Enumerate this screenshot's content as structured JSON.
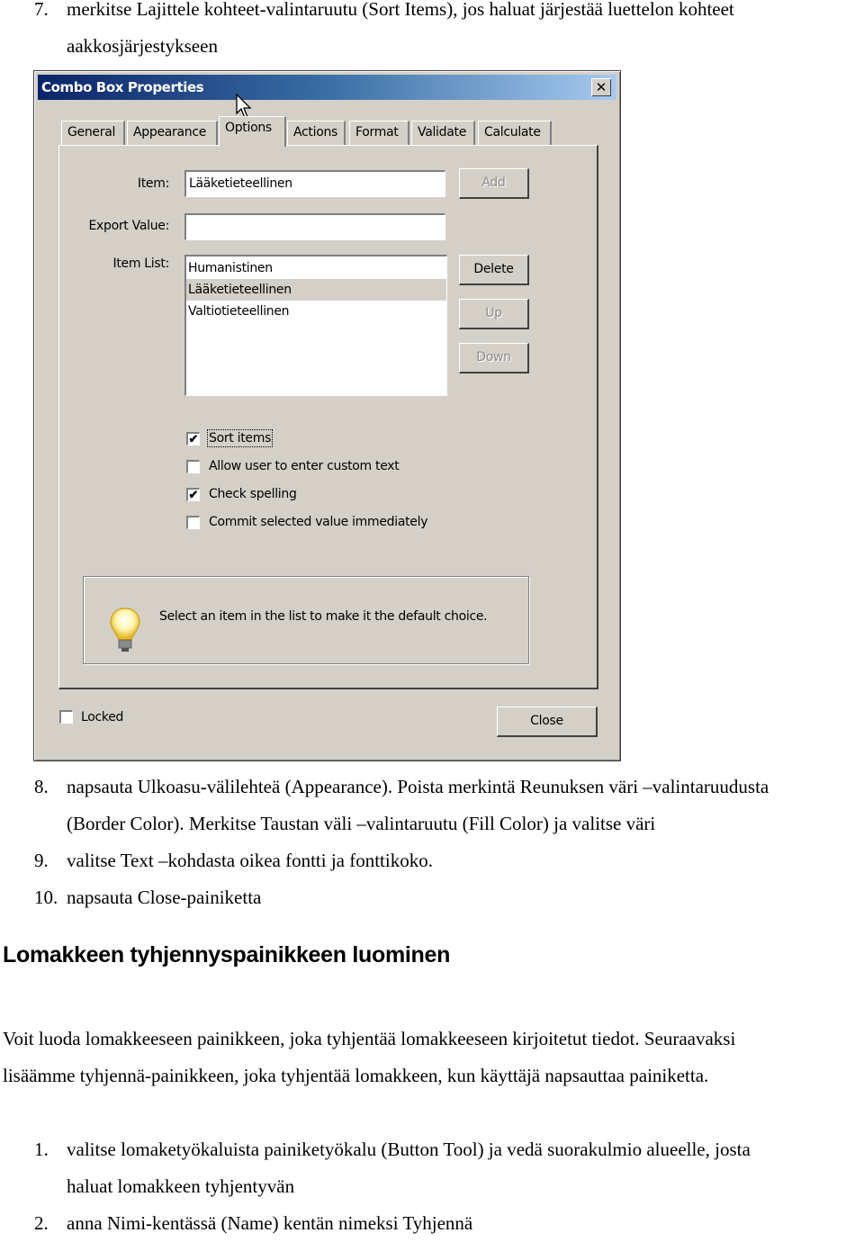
{
  "intro_steps": [
    {
      "num": "7.",
      "lines": [
        "merkitse Lajittele kohteet-valintaruutu (Sort Items), jos haluat järjestää luettelon kohteet",
        "aakkosjärjestykseen"
      ]
    }
  ],
  "dialog": {
    "title": "Combo Box Properties",
    "close_glyph": "✕",
    "tabs": [
      "General",
      "Appearance",
      "Options",
      "Actions",
      "Format",
      "Validate",
      "Calculate"
    ],
    "active_tab": "Options",
    "item_label": "Item:",
    "item_value": "Lääketieteellinen",
    "export_label": "Export Value:",
    "export_value": "",
    "item_list_label": "Item List:",
    "item_list": [
      "Humanistinen",
      "Lääketieteellinen",
      "Valtiotieteellinen"
    ],
    "selected_item": "Lääketieteellinen",
    "buttons": {
      "add": "Add",
      "delete": "Delete",
      "up": "Up",
      "down": "Down",
      "close": "Close"
    },
    "checkboxes": [
      {
        "label": "Sort items",
        "checked": true
      },
      {
        "label": "Allow user to enter custom text",
        "checked": false
      },
      {
        "label": "Check spelling",
        "checked": true
      },
      {
        "label": "Commit selected value immediately",
        "checked": false
      }
    ],
    "hint_icon": "lightbulb-icon",
    "hint_text": "Select an item in the list to make it the default choice.",
    "locked_label": "Locked",
    "locked_checked": false,
    "check_glyph": "✔"
  },
  "after_steps": [
    {
      "num": "8.",
      "lines": [
        "napsauta Ulkoasu-välilehteä (Appearance). Poista merkintä Reunuksen väri –valintaruudusta",
        "(Border Color). Merkitse Taustan väli –valintaruutu (Fill Color) ja valitse väri"
      ]
    },
    {
      "num": "9.",
      "lines": [
        "valitse Text –kohdasta oikea fontti ja fonttikoko."
      ]
    },
    {
      "num": "10.",
      "lines": [
        "napsauta Close-painiketta"
      ]
    }
  ],
  "section_heading": "Lomakkeen tyhjennyspainikkeen luominen",
  "paragraph_lines": [
    "Voit luoda lomakkeeseen painikkeen, joka tyhjentää lomakkeeseen kirjoitetut tiedot. Seuraavaksi",
    "lisäämme tyhjennä-painikkeen, joka tyhjentää lomakkeen, kun käyttäjä napsauttaa painiketta."
  ],
  "final_steps": [
    {
      "num": "1.",
      "lines": [
        "valitse lomaketyökaluista painiketyökalu (Button Tool) ja vedä suorakulmio alueelle, josta",
        "haluat lomakkeen tyhjentyvän"
      ]
    },
    {
      "num": "2.",
      "lines": [
        "anna Nimi-kentässä (Name) kentän nimeksi Tyhjennä"
      ]
    }
  ]
}
